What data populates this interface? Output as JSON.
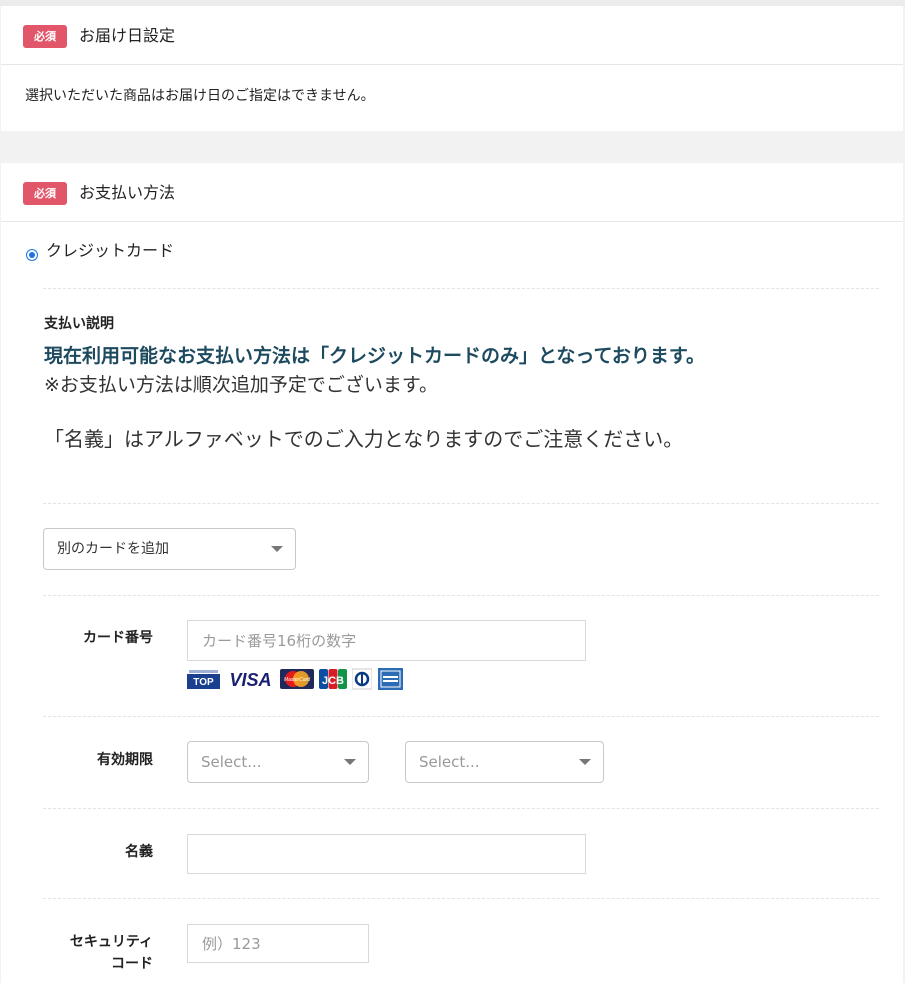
{
  "delivery": {
    "badge": "必須",
    "title": "お届け日設定",
    "message": "選択いただいた商品はお届け日のご指定はできません。"
  },
  "payment": {
    "badge": "必須",
    "title": "お支払い方法",
    "method_label": "クレジットカード",
    "method_selected": true,
    "desc_title": "支払い説明",
    "desc_main": "現在利用可能なお支払い方法は「クレジットカードのみ」となっております。",
    "desc_note": "※お支払い方法は順次追加予定でございます。",
    "desc_name": "「名義」はアルファベットでのご入力となりますのでご注意ください。",
    "card_select": "別のカードを追加",
    "fields": {
      "card_number_label": "カード番号",
      "card_number_placeholder": "カード番号16桁の数字",
      "expiry_label": "有効期限",
      "expiry_month_placeholder": "Select...",
      "expiry_year_placeholder": "Select...",
      "holder_label": "名義",
      "security_label_1": "セキュリティ",
      "security_label_2": "コード",
      "security_placeholder": "例）123"
    },
    "card_brands": [
      {
        "name": "TOP",
        "icon": "top-card-icon"
      },
      {
        "name": "VISA",
        "icon": "visa-icon"
      },
      {
        "name": "MasterCard",
        "icon": "mastercard-icon"
      },
      {
        "name": "JCB",
        "icon": "jcb-icon"
      },
      {
        "name": "Diners Club",
        "icon": "diners-icon"
      },
      {
        "name": "AMERICAN EXPRESS",
        "icon": "amex-icon"
      }
    ]
  },
  "colors": {
    "badge": "#e2566a",
    "accent_text": "#1d4a5f",
    "radio": "#1a73e8",
    "background": "#f2f2f2"
  }
}
